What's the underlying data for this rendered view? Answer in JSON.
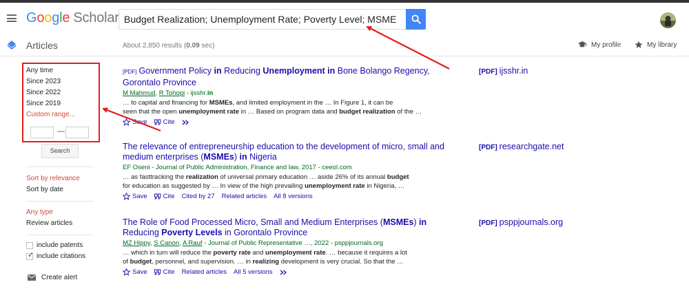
{
  "header": {
    "logo_google": [
      "G",
      "o",
      "o",
      "g",
      "l",
      "e"
    ],
    "logo_scholar": "Scholar",
    "search_query": "Budget Realization; Unemployment Rate; Poverty Level; MSME"
  },
  "subheader": {
    "section_label": "Articles",
    "results_prefix": "About 2,850 results (",
    "results_time": "0.09",
    "results_suffix": " sec)",
    "my_profile": "My profile",
    "my_library": "My library"
  },
  "sidebar": {
    "time_filters": [
      "Any time",
      "Since 2023",
      "Since 2022",
      "Since 2019",
      "Custom range..."
    ],
    "range_dash": "—",
    "search_button": "Search",
    "sort_relevance": "Sort by relevance",
    "sort_date": "Sort by date",
    "any_type": "Any type",
    "review_articles": "Review articles",
    "include_patents": "include patents",
    "include_citations": "include citations",
    "create_alert": "Create alert"
  },
  "results": [
    {
      "pdf_tag": "[PDF]",
      "title_parts": [
        "Government Policy ",
        "in",
        " Reducing ",
        "Unemployment in",
        " Bone Bolango Regency, Gorontalo Province"
      ],
      "authors": [
        "M Mahmud",
        "R Tohopi"
      ],
      "source_prefix": " - ijsshr.",
      "source_bold": "in",
      "snippet_line1": [
        "… to capital and financing for ",
        "MSMEs",
        ", and limited employment in the … In Figure 1, it can be"
      ],
      "snippet_line2": [
        "seen that the open ",
        "unemployment rate",
        " in … Based on program data and ",
        "budget realization",
        " of the …"
      ],
      "actions": [
        "Save",
        "Cite"
      ],
      "side_pdf": "[PDF]",
      "side_domain": "ijsshr.in"
    },
    {
      "title_parts": [
        "The relevance of entrepreneurship education to the development of micro, small and medium enterprises (",
        "MSMEs",
        ") ",
        "in",
        " Nigeria"
      ],
      "byline": "EF Oseni - Journal of Public Administration, Finance and law, 2017 - ceeol.com",
      "snippet_line1": [
        "… as fasttracking the ",
        "realization",
        " of universal primary education … aside 26% of its annual ",
        "budget"
      ],
      "snippet_line2": [
        "for education as suggested by … In view of the high prevailing ",
        "unemployment rate",
        " in Nigeria, …"
      ],
      "actions": [
        "Save",
        "Cite",
        "Cited by 27",
        "Related articles",
        "All 8 versions"
      ],
      "side_pdf": "[PDF]",
      "side_domain": "researchgate.net"
    },
    {
      "title_parts": [
        "The Role of Food Processed Micro, Small and Medium Enterprises (",
        "MSMEs",
        ") ",
        "in",
        " Reducing ",
        "Poverty Levels",
        " in Gorontalo Province"
      ],
      "authors": [
        "MZ Hippy",
        "S Canon",
        "A Rauf"
      ],
      "source_rest": " - Journal of Public Representative …, 2022 - psppjournals.org",
      "snippet_line1": [
        "… which in turn will reduce the ",
        "poverty rate",
        " and ",
        "unemployment rate",
        ". … because it requires a lot"
      ],
      "snippet_line2": [
        "of ",
        "budget",
        ", personnel, and supervision. … in ",
        "realizing",
        " development is very crucial. So that the …"
      ],
      "actions": [
        "Save",
        "Cite",
        "Related articles",
        "All 5 versions"
      ],
      "side_pdf": "[PDF]",
      "side_domain": "psppjournals.org"
    }
  ],
  "colors": {
    "link": "#1a0dab",
    "green": "#006621",
    "accent_red": "#d14836",
    "annotation_red": "#e31c1c",
    "search_blue": "#4285f4"
  }
}
